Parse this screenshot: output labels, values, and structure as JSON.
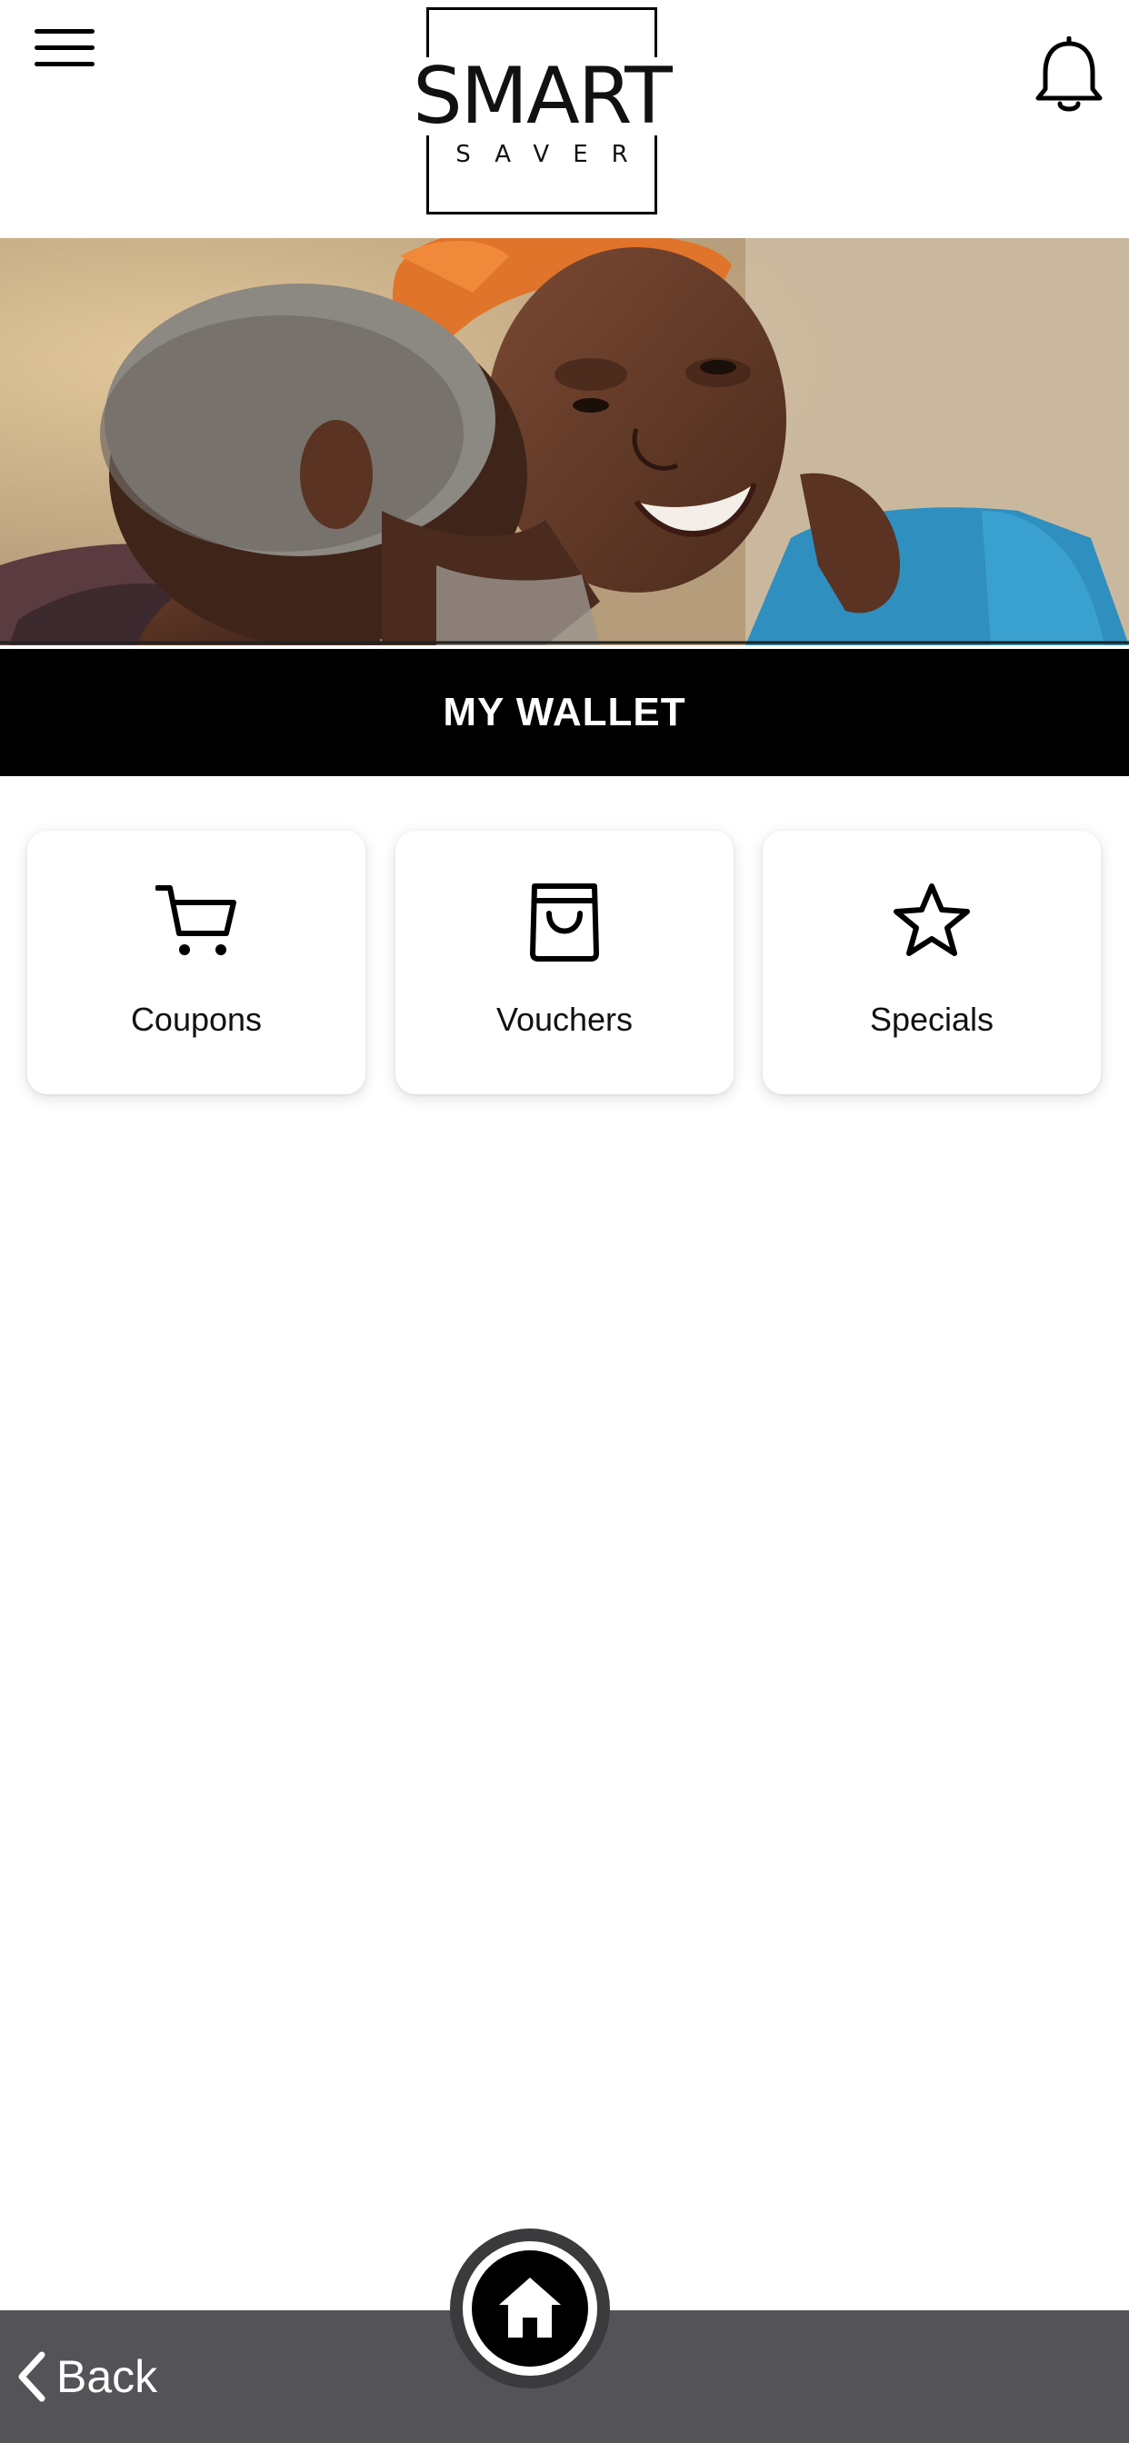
{
  "header": {
    "logo_main": "SMART",
    "logo_sub": "SAVER",
    "menu_icon": "hamburger-menu-icon",
    "notification_icon": "bell-icon"
  },
  "hero": {
    "image": "photo-elderly-couple-embracing"
  },
  "page_title": "MY WALLET",
  "cards": [
    {
      "label": "Coupons",
      "icon": "shopping-cart-icon"
    },
    {
      "label": "Vouchers",
      "icon": "shopping-bag-icon"
    },
    {
      "label": "Specials",
      "icon": "star-icon"
    }
  ],
  "bottom_bar": {
    "back_label": "Back",
    "back_icon": "chevron-left-icon",
    "home_icon": "home-icon"
  },
  "colors": {
    "title_bar_bg": "#000000",
    "title_bar_text": "#ffffff",
    "bottom_bar_bg": "#545357",
    "page_bg": "#ffffff"
  }
}
